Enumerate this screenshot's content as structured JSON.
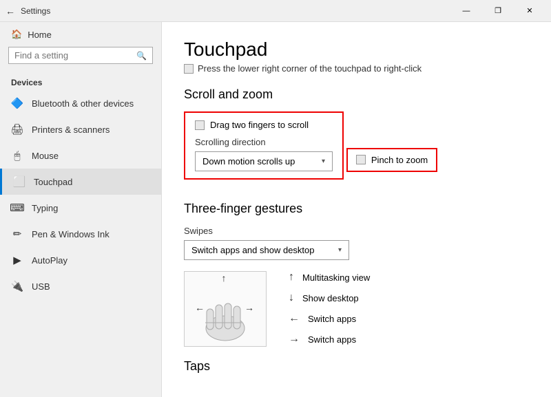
{
  "titlebar": {
    "back_icon": "←",
    "title": "Settings",
    "btn_minimize": "—",
    "btn_restore": "❐",
    "btn_close": "✕"
  },
  "sidebar": {
    "back_label": "Home",
    "search_placeholder": "Find a setting",
    "section_label": "Devices",
    "items": [
      {
        "id": "bluetooth",
        "icon": "🔷",
        "label": "Bluetooth & other devices"
      },
      {
        "id": "printers",
        "icon": "🖨",
        "label": "Printers & scanners"
      },
      {
        "id": "mouse",
        "icon": "🖱",
        "label": "Mouse"
      },
      {
        "id": "touchpad",
        "icon": "⬜",
        "label": "Touchpad",
        "active": true
      },
      {
        "id": "typing",
        "icon": "⌨",
        "label": "Typing"
      },
      {
        "id": "pen",
        "icon": "✏",
        "label": "Pen & Windows Ink"
      },
      {
        "id": "autoplay",
        "icon": "▶",
        "label": "AutoPlay"
      },
      {
        "id": "usb",
        "icon": "🔌",
        "label": "USB"
      }
    ]
  },
  "content": {
    "page_title": "Touchpad",
    "right_click_label": "Press the lower right corner of the touchpad to right-click",
    "scroll_zoom_title": "Scroll and zoom",
    "drag_fingers_label": "Drag two fingers to scroll",
    "scroll_direction_label": "Scrolling direction",
    "scroll_direction_value": "Down motion scrolls up",
    "pinch_zoom_label": "Pinch to zoom",
    "three_finger_title": "Three-finger gestures",
    "swipes_label": "Swipes",
    "swipes_value": "Switch apps and show desktop",
    "gestures": [
      {
        "arrow": "↑",
        "description": "Multitasking view"
      },
      {
        "arrow": "↓",
        "description": "Show desktop"
      },
      {
        "arrow": "←",
        "description": "Switch apps"
      },
      {
        "arrow": "→",
        "description": "Switch apps"
      }
    ],
    "taps_label": "Taps"
  }
}
